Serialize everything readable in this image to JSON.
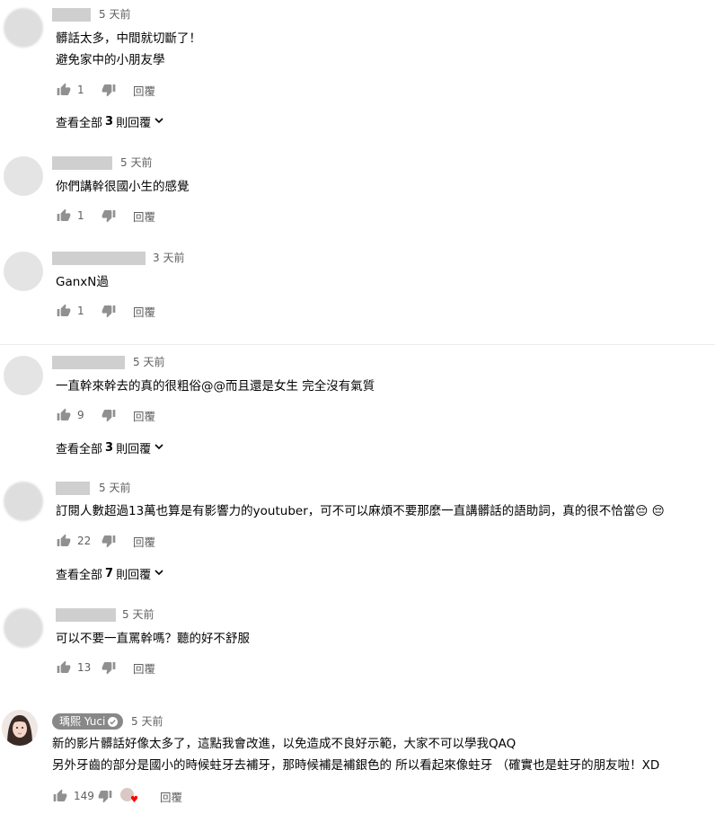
{
  "comments": [
    {
      "time": "5 天前",
      "lines": [
        "髒話太多，中間就切斷了！",
        "避免家中的小朋友學"
      ],
      "likes": "1",
      "reply_label": "回覆",
      "view_replies": {
        "prefix": "查看全部",
        "count": "3",
        "suffix": "則回覆"
      }
    },
    {
      "time": "5 天前",
      "lines": [
        "你們講幹很國小生的感覺"
      ],
      "likes": "1",
      "reply_label": "回覆"
    },
    {
      "time": "3 天前",
      "lines": [
        "GanxN過"
      ],
      "likes": "1",
      "reply_label": "回覆"
    },
    {
      "time": "5 天前",
      "lines": [
        "一直幹來幹去的真的很粗俗@@而且還是女生 完全沒有氣質"
      ],
      "likes": "9",
      "reply_label": "回覆",
      "view_replies": {
        "prefix": "查看全部",
        "count": "3",
        "suffix": "則回覆"
      }
    },
    {
      "time": "5 天前",
      "lines": [
        "訂閱人數超過13萬也算是有影響力的youtuber，可不可以麻煩不要那麼一直講髒話的語助詞，真的很不恰當😔 😔"
      ],
      "likes": "22",
      "reply_label": "回覆",
      "view_replies": {
        "prefix": "查看全部",
        "count": "7",
        "suffix": "則回覆"
      }
    },
    {
      "time": "5 天前",
      "lines": [
        "可以不要一直罵幹嗎？聽的好不舒服"
      ],
      "likes": "13",
      "reply_label": "回覆"
    },
    {
      "author": "瑀熙 Yuci",
      "time": "5 天前",
      "lines": [
        "新的影片髒話好像太多了，這點我會改進，以免造成不良好示範，大家不可以學我QAQ",
        "另外牙齒的部分是國小的時候蛀牙去補牙，那時候補是補銀色的 所以看起來像蛀牙 （確實也是蛀牙的朋友啦！XD"
      ],
      "likes": "149",
      "reply_label": "回覆"
    }
  ],
  "icons": {
    "like": "thumb-up-icon",
    "dislike": "thumb-down-icon",
    "expand": "chevron-down-icon",
    "verified": "check-icon",
    "creator_heart": "heart-icon"
  },
  "colors": {
    "meta": "#606060",
    "text": "#030303",
    "chip": "#888888",
    "heart": "#ff0000"
  }
}
